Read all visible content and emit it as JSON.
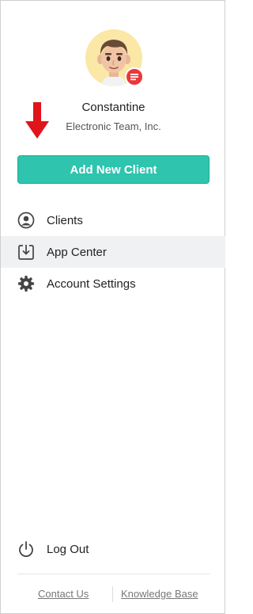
{
  "user": {
    "name": "Constantine",
    "company": "Electronic Team, Inc."
  },
  "actions": {
    "add_client_label": "Add New Client"
  },
  "nav": {
    "items": [
      {
        "label": "Clients",
        "icon": "user-circle-icon",
        "active": false
      },
      {
        "label": "App Center",
        "icon": "download-box-icon",
        "active": true
      },
      {
        "label": "Account Settings",
        "icon": "gear-icon",
        "active": false
      }
    ]
  },
  "logout": {
    "label": "Log Out",
    "icon": "power-icon"
  },
  "footer": {
    "contact_label": "Contact Us",
    "kb_label": "Knowledge Base"
  },
  "colors": {
    "accent": "#2ec4ae",
    "badge": "#e8383d",
    "arrow": "#e0141b",
    "avatar_bg": "#fbe7a6",
    "active_bg": "#f0f1f3"
  }
}
